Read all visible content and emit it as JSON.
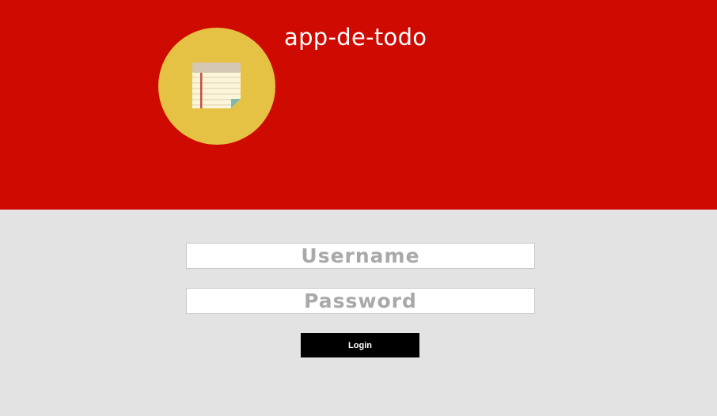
{
  "header": {
    "app_title": "app-de-todo",
    "logo_icon": "notepad-icon",
    "background_color": "#cf0a00",
    "logo_color": "#e6c244"
  },
  "login": {
    "username_placeholder": "Username",
    "username_value": "",
    "password_placeholder": "Password",
    "password_value": "",
    "button_label": "Login",
    "button_color": "#000000"
  },
  "page": {
    "background_color": "#e2e3e2"
  }
}
